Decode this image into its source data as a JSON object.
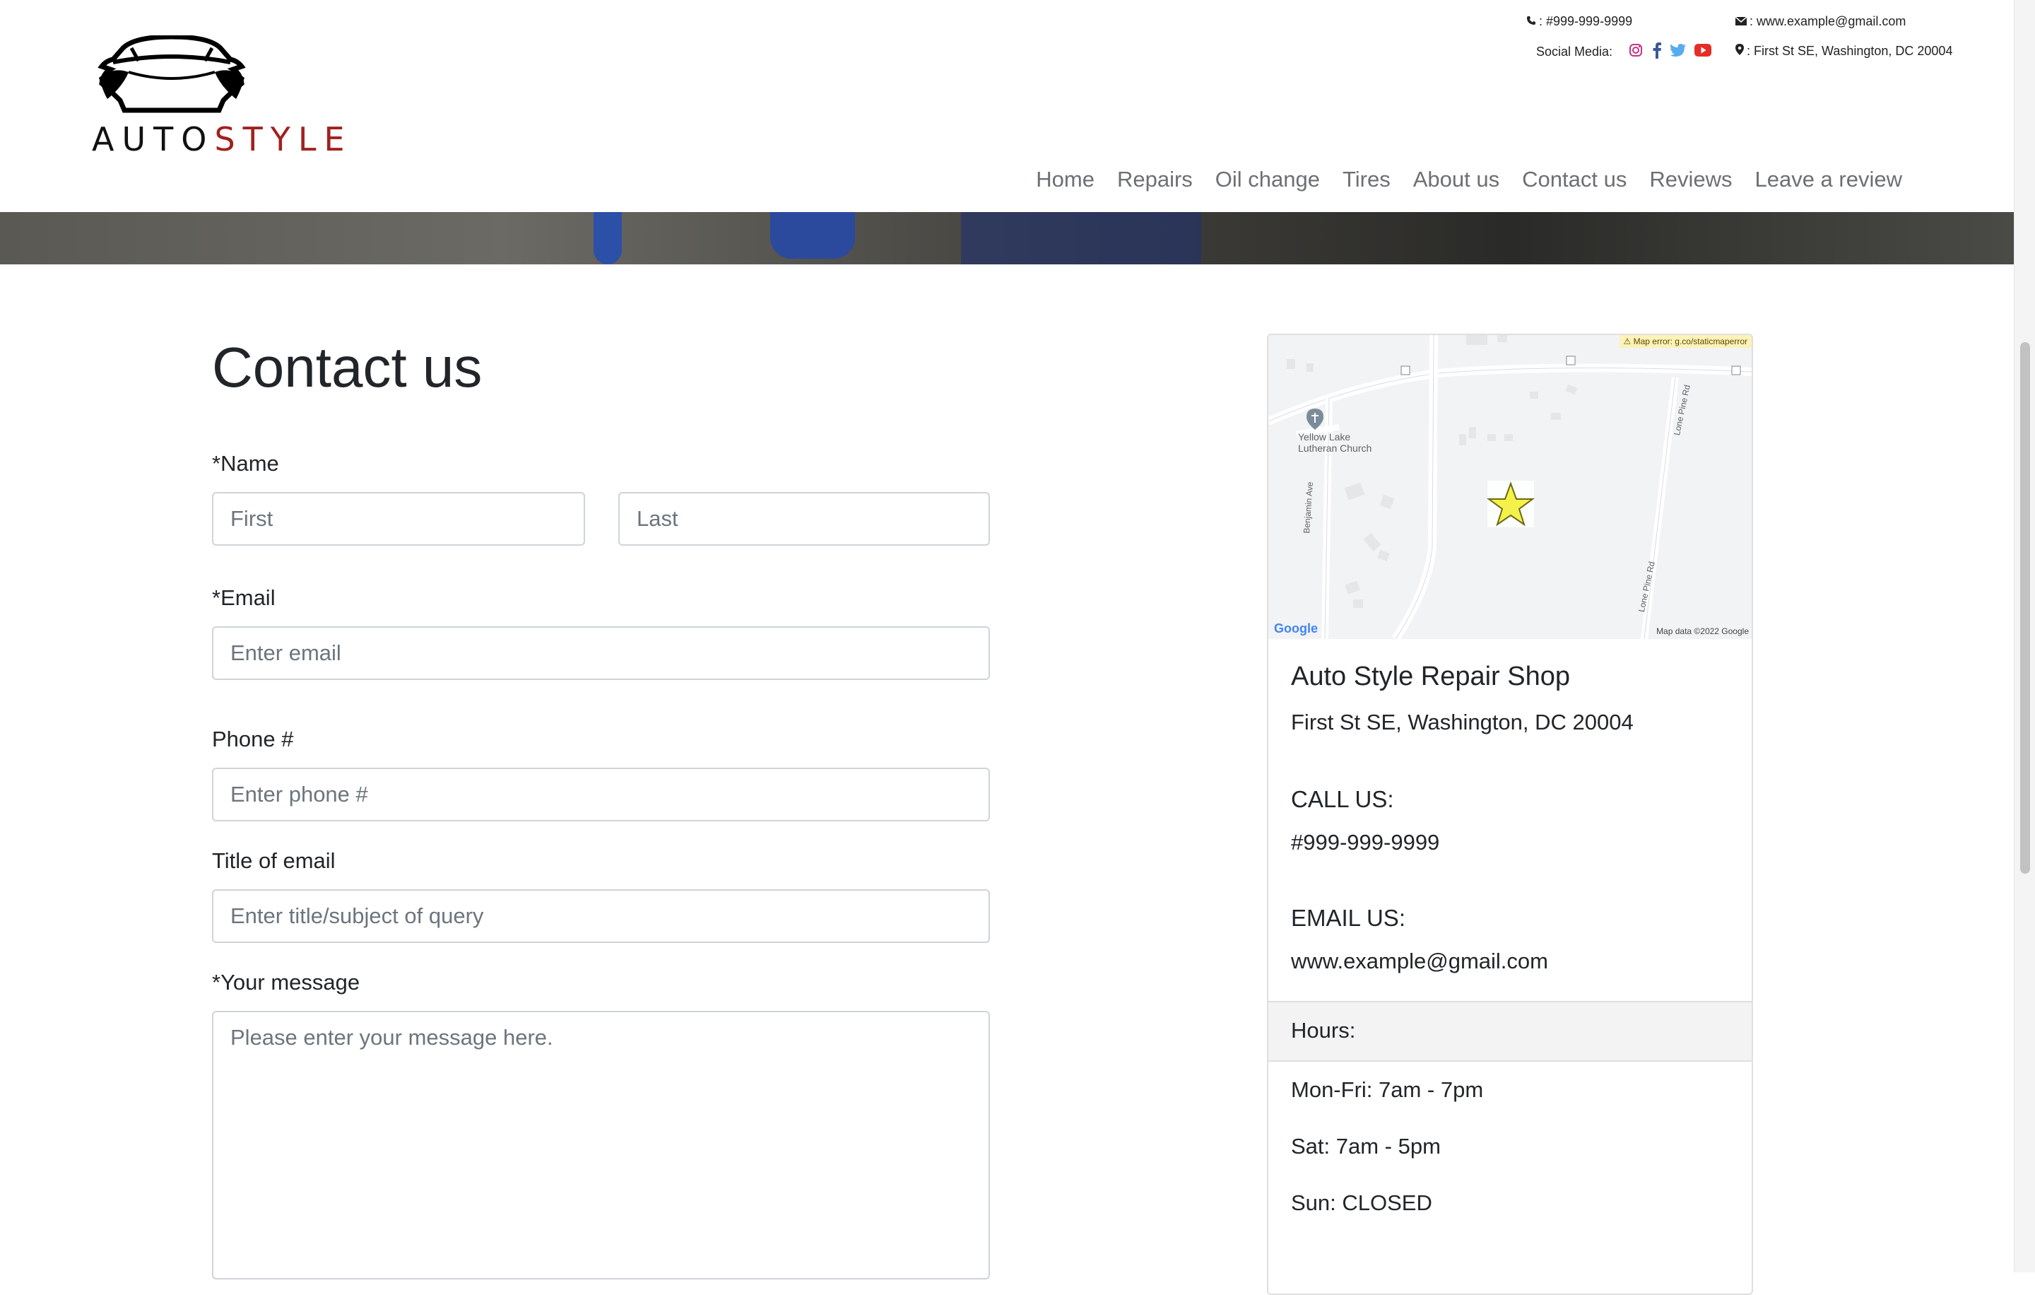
{
  "header": {
    "logo": {
      "word_dark": "AUTO",
      "word_accent": "STYLE",
      "accent_color": "#a0211f"
    },
    "contact": {
      "phone": ": #999-999-9999",
      "email": ": www.example@gmail.com",
      "address": ": First St SE, Washington, DC 20004",
      "social_label": "Social Media:",
      "social_icons": [
        "instagram-icon",
        "facebook-icon",
        "twitter-icon",
        "youtube-icon"
      ]
    },
    "nav": [
      "Home",
      "Repairs",
      "Oil change",
      "Tires",
      "About us",
      "Contact us",
      "Reviews",
      "Leave a review"
    ]
  },
  "form": {
    "title": "Contact us",
    "name_label": "*Name",
    "first_placeholder": "First",
    "last_placeholder": "Last",
    "email_label": "*Email",
    "email_placeholder": "Enter email",
    "phone_label": "Phone #",
    "phone_placeholder": "Enter phone #",
    "subject_label": "Title of email",
    "subject_placeholder": "Enter title/subject of query",
    "message_label": "*Your message",
    "message_placeholder": "Please enter your message here."
  },
  "card": {
    "map": {
      "error": "⚠ Map error: g.co/staticmaperror",
      "church": "Yellow Lake\nLutheran Church",
      "street_benjamin": "Benjamin Ave",
      "street_lone_pine_1": "Lone Pine Rd",
      "street_lone_pine_2": "Lone Pine Rd",
      "google": "Google",
      "copyright": "Map data ©2022 Google"
    },
    "name": "Auto Style Repair Shop",
    "address": "First St SE, Washington, DC 20004",
    "call_heading": "CALL US:",
    "phone": "#999-999-9999",
    "email_heading": "EMAIL US:",
    "email": "www.example@gmail.com",
    "hours_heading": "Hours:",
    "hours": [
      "Mon-Fri: 7am - 7pm",
      "Sat: 7am - 5pm",
      "Sun: CLOSED"
    ]
  }
}
